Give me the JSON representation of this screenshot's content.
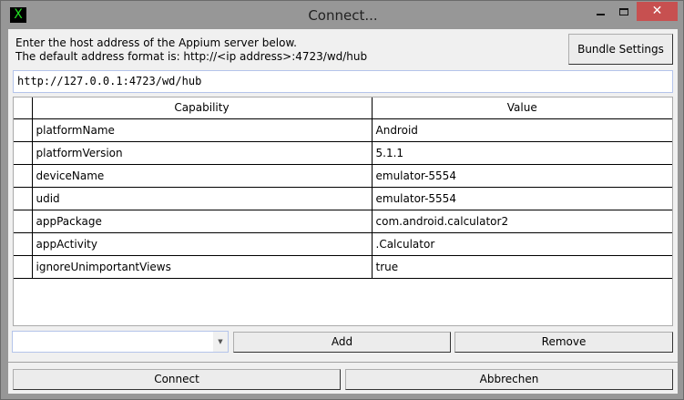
{
  "window": {
    "title": "Connect...",
    "app_icon": "X"
  },
  "instructions": {
    "line1": "Enter the host address of the Appium server below.",
    "line2": "The default address format is: http://<ip address>:4723/wd/hub"
  },
  "bundle_button": "Bundle Settings",
  "url_input": {
    "value": "http://127.0.0.1:4723/wd/hub"
  },
  "table": {
    "headers": [
      "Capability",
      "Value"
    ],
    "rows": [
      {
        "capability": "platformName",
        "value": "Android"
      },
      {
        "capability": "platformVersion",
        "value": "5.1.1"
      },
      {
        "capability": "deviceName",
        "value": "emulator-5554"
      },
      {
        "capability": "udid",
        "value": "emulator-5554"
      },
      {
        "capability": "appPackage",
        "value": "com.android.calculator2"
      },
      {
        "capability": "appActivity",
        "value": ".Calculator"
      },
      {
        "capability": "ignoreUnimportantViews",
        "value": "true"
      }
    ]
  },
  "combo": {
    "value": ""
  },
  "add_button": "Add",
  "remove_button": "Remove",
  "connect_button": "Connect",
  "cancel_button": "Abbrechen"
}
